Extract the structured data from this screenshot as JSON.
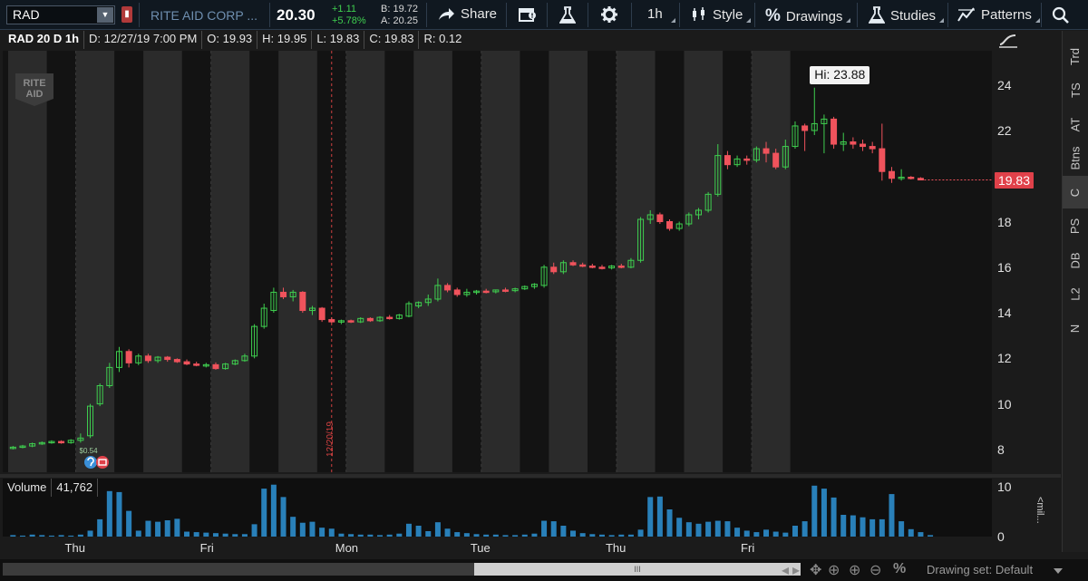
{
  "toolbar": {
    "symbol": "RAD",
    "company_name": "RITE AID CORP ...",
    "last_price": "20.30",
    "net_change": "+1.11",
    "pct_change": "+5.78%",
    "bid": "B: 19.72",
    "ask": "A: 20.25",
    "share_label": "Share",
    "timeframe_label": "1h",
    "style_label": "Style",
    "drawings_label": "Drawings",
    "studies_label": "Studies",
    "patterns_label": "Patterns",
    "icons": {
      "symbol_dropdown": "chevron-down-icon",
      "alert": "red-flag-icon",
      "share": "share-arrow-icon",
      "calendar_alert": "calendar-alert-icon",
      "flask": "flask-icon",
      "gear": "gear-icon",
      "style": "candlestick-icon",
      "drawings": "percent-icon",
      "studies": "flask-icon",
      "patterns": "pattern-icon",
      "search": "search-icon"
    }
  },
  "info_bar": {
    "title": "RAD 20 D 1h",
    "date": "D: 12/27/19 7:00 PM",
    "open": "O: 19.93",
    "high": "H: 19.95",
    "low": "L: 19.83",
    "close": "C: 19.83",
    "range": "R: 0.12"
  },
  "chart_overlay": {
    "logo_line1": "RITE",
    "logo_line2": "AID",
    "hi_label": "Hi: 23.88",
    "last_price_tag": "19.83",
    "eps_label": "$0.54",
    "date_marker_label": "12/20/19"
  },
  "volume": {
    "label": "Volume",
    "value": "41,762",
    "unit": "<mil..."
  },
  "sidebar": {
    "tabs": [
      "Trd",
      "TS",
      "AT",
      "Btns",
      "C",
      "PS",
      "DB",
      "L2",
      "N"
    ],
    "active": "C"
  },
  "bottom_bar": {
    "drawing_set": "Drawing set: Default",
    "scroll_label": "III"
  },
  "colors": {
    "up": "#3fcf4f",
    "down": "#f0535c",
    "volume": "#2980b9",
    "band_light": "#2b2b2b",
    "band_dark": "#131313",
    "date_marker": "#d04040"
  },
  "chart_data": [
    {
      "type": "candlestick",
      "title": "RAD 20 D 1h",
      "y_ticks": [
        8,
        10,
        12,
        14,
        16,
        18,
        20,
        22,
        24
      ],
      "y_tick_labels": [
        "8",
        "10",
        "12",
        "14",
        "16",
        "18",
        "22",
        "24"
      ],
      "ylim": [
        7.0,
        25.5
      ],
      "x_labels": [
        "Thu",
        "Fri",
        "Mon",
        "Tue",
        "Thu",
        "Fri"
      ],
      "x_label_index": [
        7,
        21,
        35,
        49,
        63,
        77
      ],
      "bands": [
        [
          0,
          3
        ],
        [
          7,
          10
        ],
        [
          14,
          17
        ],
        [
          21,
          24
        ],
        [
          28,
          31
        ],
        [
          35,
          38
        ],
        [
          42,
          45
        ],
        [
          49,
          52
        ],
        [
          56,
          59
        ],
        [
          63,
          66
        ],
        [
          70,
          73
        ],
        [
          77,
          80
        ]
      ],
      "candles": [
        {
          "o": 8.05,
          "h": 8.15,
          "l": 8.0,
          "c": 8.1
        },
        {
          "o": 8.1,
          "h": 8.2,
          "l": 8.05,
          "c": 8.15
        },
        {
          "o": 8.15,
          "h": 8.3,
          "l": 8.1,
          "c": 8.25
        },
        {
          "o": 8.25,
          "h": 8.35,
          "l": 8.2,
          "c": 8.3
        },
        {
          "o": 8.3,
          "h": 8.4,
          "l": 8.25,
          "c": 8.35
        },
        {
          "o": 8.35,
          "h": 8.4,
          "l": 8.25,
          "c": 8.3
        },
        {
          "o": 8.3,
          "h": 8.45,
          "l": 8.25,
          "c": 8.4
        },
        {
          "o": 8.4,
          "h": 8.7,
          "l": 8.3,
          "c": 8.5
        },
        {
          "o": 8.6,
          "h": 10.0,
          "l": 8.5,
          "c": 9.9
        },
        {
          "o": 10.0,
          "h": 10.9,
          "l": 9.9,
          "c": 10.8
        },
        {
          "o": 10.8,
          "h": 11.8,
          "l": 10.7,
          "c": 11.6
        },
        {
          "o": 11.6,
          "h": 12.5,
          "l": 11.4,
          "c": 12.3
        },
        {
          "o": 12.3,
          "h": 12.4,
          "l": 11.6,
          "c": 11.8
        },
        {
          "o": 11.8,
          "h": 12.2,
          "l": 11.7,
          "c": 12.1
        },
        {
          "o": 12.1,
          "h": 12.2,
          "l": 11.8,
          "c": 11.9
        },
        {
          "o": 11.9,
          "h": 12.1,
          "l": 11.8,
          "c": 12.05
        },
        {
          "o": 12.05,
          "h": 12.1,
          "l": 11.85,
          "c": 11.95
        },
        {
          "o": 11.95,
          "h": 12.0,
          "l": 11.8,
          "c": 11.85
        },
        {
          "o": 11.85,
          "h": 11.95,
          "l": 11.7,
          "c": 11.75
        },
        {
          "o": 11.75,
          "h": 11.85,
          "l": 11.65,
          "c": 11.7
        },
        {
          "o": 11.7,
          "h": 11.8,
          "l": 11.6,
          "c": 11.72
        },
        {
          "o": 11.72,
          "h": 11.82,
          "l": 11.5,
          "c": 11.55
        },
        {
          "o": 11.55,
          "h": 11.8,
          "l": 11.5,
          "c": 11.75
        },
        {
          "o": 11.75,
          "h": 11.95,
          "l": 11.7,
          "c": 11.9
        },
        {
          "o": 11.9,
          "h": 12.2,
          "l": 11.85,
          "c": 12.1
        },
        {
          "o": 12.1,
          "h": 13.5,
          "l": 12.0,
          "c": 13.4
        },
        {
          "o": 13.4,
          "h": 14.4,
          "l": 13.3,
          "c": 14.2
        },
        {
          "o": 14.1,
          "h": 15.1,
          "l": 14.0,
          "c": 14.9
        },
        {
          "o": 14.9,
          "h": 15.1,
          "l": 14.6,
          "c": 14.7
        },
        {
          "o": 14.7,
          "h": 15.0,
          "l": 14.5,
          "c": 14.9
        },
        {
          "o": 14.9,
          "h": 14.95,
          "l": 14.0,
          "c": 14.1
        },
        {
          "o": 14.1,
          "h": 14.3,
          "l": 13.9,
          "c": 14.2
        },
        {
          "o": 14.2,
          "h": 14.25,
          "l": 13.6,
          "c": 13.7
        },
        {
          "o": 13.7,
          "h": 13.8,
          "l": 13.55,
          "c": 13.6
        },
        {
          "o": 13.6,
          "h": 13.7,
          "l": 13.5,
          "c": 13.65
        },
        {
          "o": 13.65,
          "h": 13.7,
          "l": 13.55,
          "c": 13.6
        },
        {
          "o": 13.6,
          "h": 13.8,
          "l": 13.55,
          "c": 13.75
        },
        {
          "o": 13.75,
          "h": 13.8,
          "l": 13.6,
          "c": 13.65
        },
        {
          "o": 13.65,
          "h": 13.85,
          "l": 13.6,
          "c": 13.8
        },
        {
          "o": 13.8,
          "h": 13.9,
          "l": 13.7,
          "c": 13.75
        },
        {
          "o": 13.75,
          "h": 13.95,
          "l": 13.7,
          "c": 13.9
        },
        {
          "o": 13.85,
          "h": 14.5,
          "l": 13.8,
          "c": 14.4
        },
        {
          "o": 14.3,
          "h": 14.5,
          "l": 14.2,
          "c": 14.45
        },
        {
          "o": 14.45,
          "h": 14.8,
          "l": 14.3,
          "c": 14.6
        },
        {
          "o": 14.6,
          "h": 15.5,
          "l": 14.5,
          "c": 15.2
        },
        {
          "o": 15.2,
          "h": 15.3,
          "l": 14.9,
          "c": 15.0
        },
        {
          "o": 15.0,
          "h": 15.1,
          "l": 14.7,
          "c": 14.8
        },
        {
          "o": 14.8,
          "h": 15.05,
          "l": 14.7,
          "c": 14.9
        },
        {
          "o": 14.9,
          "h": 15.0,
          "l": 14.8,
          "c": 14.95
        },
        {
          "o": 14.95,
          "h": 15.05,
          "l": 14.85,
          "c": 14.92
        },
        {
          "o": 14.92,
          "h": 15.02,
          "l": 14.85,
          "c": 15.0
        },
        {
          "o": 15.0,
          "h": 15.1,
          "l": 14.9,
          "c": 14.97
        },
        {
          "o": 14.97,
          "h": 15.1,
          "l": 14.9,
          "c": 15.05
        },
        {
          "o": 15.05,
          "h": 15.2,
          "l": 15.0,
          "c": 15.15
        },
        {
          "o": 15.15,
          "h": 15.3,
          "l": 15.05,
          "c": 15.25
        },
        {
          "o": 15.2,
          "h": 16.1,
          "l": 15.1,
          "c": 16.0
        },
        {
          "o": 16.0,
          "h": 16.2,
          "l": 15.7,
          "c": 15.8
        },
        {
          "o": 15.8,
          "h": 16.3,
          "l": 15.7,
          "c": 16.2
        },
        {
          "o": 16.2,
          "h": 16.3,
          "l": 16.05,
          "c": 16.1
        },
        {
          "o": 16.1,
          "h": 16.2,
          "l": 16.0,
          "c": 16.05
        },
        {
          "o": 16.05,
          "h": 16.15,
          "l": 15.95,
          "c": 16.0
        },
        {
          "o": 16.0,
          "h": 16.1,
          "l": 15.9,
          "c": 15.97
        },
        {
          "o": 15.97,
          "h": 16.1,
          "l": 15.9,
          "c": 16.05
        },
        {
          "o": 16.05,
          "h": 16.15,
          "l": 15.95,
          "c": 16.0
        },
        {
          "o": 16.0,
          "h": 16.4,
          "l": 15.95,
          "c": 16.3
        },
        {
          "o": 16.3,
          "h": 18.2,
          "l": 16.2,
          "c": 18.1
        },
        {
          "o": 18.1,
          "h": 18.5,
          "l": 17.9,
          "c": 18.3
        },
        {
          "o": 18.3,
          "h": 18.4,
          "l": 17.9,
          "c": 18.0
        },
        {
          "o": 18.0,
          "h": 18.1,
          "l": 17.6,
          "c": 17.7
        },
        {
          "o": 17.7,
          "h": 18.0,
          "l": 17.6,
          "c": 17.9
        },
        {
          "o": 17.9,
          "h": 18.4,
          "l": 17.8,
          "c": 18.3
        },
        {
          "o": 18.3,
          "h": 18.6,
          "l": 18.1,
          "c": 18.5
        },
        {
          "o": 18.5,
          "h": 19.3,
          "l": 18.4,
          "c": 19.2
        },
        {
          "o": 19.2,
          "h": 21.4,
          "l": 19.1,
          "c": 20.9
        },
        {
          "o": 20.9,
          "h": 21.1,
          "l": 20.3,
          "c": 20.5
        },
        {
          "o": 20.5,
          "h": 20.9,
          "l": 20.4,
          "c": 20.75
        },
        {
          "o": 20.75,
          "h": 20.9,
          "l": 20.5,
          "c": 20.7
        },
        {
          "o": 20.7,
          "h": 21.3,
          "l": 20.6,
          "c": 21.2
        },
        {
          "o": 21.2,
          "h": 21.5,
          "l": 20.6,
          "c": 21.0
        },
        {
          "o": 21.0,
          "h": 21.2,
          "l": 20.3,
          "c": 20.4
        },
        {
          "o": 20.4,
          "h": 21.6,
          "l": 20.3,
          "c": 21.3
        },
        {
          "o": 21.3,
          "h": 22.4,
          "l": 21.2,
          "c": 22.2
        },
        {
          "o": 22.2,
          "h": 22.3,
          "l": 21.1,
          "c": 22.0
        },
        {
          "o": 22.0,
          "h": 23.88,
          "l": 21.8,
          "c": 22.3
        },
        {
          "o": 22.3,
          "h": 22.7,
          "l": 21.0,
          "c": 22.5
        },
        {
          "o": 22.5,
          "h": 22.6,
          "l": 21.2,
          "c": 21.4
        },
        {
          "o": 21.4,
          "h": 21.9,
          "l": 21.1,
          "c": 21.5
        },
        {
          "o": 21.5,
          "h": 21.7,
          "l": 21.2,
          "c": 21.4
        },
        {
          "o": 21.4,
          "h": 21.6,
          "l": 21.1,
          "c": 21.3
        },
        {
          "o": 21.3,
          "h": 21.5,
          "l": 21.0,
          "c": 21.2
        },
        {
          "o": 21.2,
          "h": 22.3,
          "l": 19.8,
          "c": 20.2
        },
        {
          "o": 20.2,
          "h": 20.4,
          "l": 19.7,
          "c": 19.9
        },
        {
          "o": 19.9,
          "h": 20.3,
          "l": 19.8,
          "c": 19.95
        },
        {
          "o": 19.95,
          "h": 20.0,
          "l": 19.85,
          "c": 19.9
        },
        {
          "o": 19.9,
          "h": 19.95,
          "l": 19.83,
          "c": 19.83
        }
      ],
      "date_marker_index": 33
    },
    {
      "type": "bar",
      "title": "Volume",
      "ylabel": "<mil...",
      "y_ticks": [
        0,
        10
      ],
      "ylim": [
        0,
        11
      ],
      "values": [
        0.3,
        0.2,
        0.4,
        0.3,
        0.2,
        0.3,
        0.2,
        0.4,
        1.2,
        3.5,
        9.2,
        9.0,
        5.2,
        1.2,
        3.2,
        3.0,
        3.3,
        3.6,
        1.0,
        0.9,
        0.8,
        0.7,
        0.6,
        0.5,
        0.5,
        2.5,
        9.7,
        10.5,
        8.0,
        4.0,
        2.8,
        3.0,
        1.8,
        1.6,
        0.6,
        0.5,
        0.4,
        0.4,
        0.3,
        0.4,
        0.6,
        2.6,
        2.2,
        1.1,
        2.9,
        1.6,
        0.9,
        0.7,
        0.5,
        0.4,
        0.4,
        0.3,
        0.3,
        0.4,
        0.6,
        3.2,
        3.1,
        2.2,
        1.2,
        0.7,
        0.5,
        0.4,
        0.3,
        0.4,
        0.4,
        1.4,
        8.0,
        8.1,
        5.5,
        3.8,
        2.9,
        2.6,
        3.0,
        3.2,
        3.1,
        1.8,
        1.2,
        0.9,
        1.4,
        1.0,
        0.8,
        2.2,
        3.1,
        10.3,
        9.7,
        7.9,
        4.4,
        4.3,
        3.9,
        3.5,
        3.5,
        8.6,
        3.1,
        1.5,
        0.9,
        0.3
      ]
    }
  ]
}
